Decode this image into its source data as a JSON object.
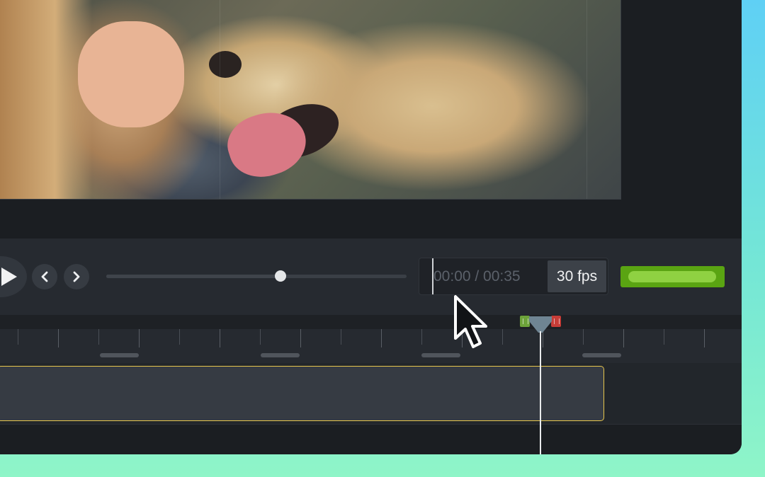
{
  "player": {
    "timecode_value": "00:00 / 00:35",
    "frame_rate": "30 fps",
    "scrubber_position": 0.58
  },
  "icons": {
    "play": "play-icon",
    "previous": "chevron-left-icon",
    "next": "chevron-right-icon",
    "cursor": "mouse-pointer-icon"
  },
  "colors": {
    "export_button": "#5aa412",
    "clip_border": "#e7c64c",
    "in_marker": "#6da33a",
    "out_marker": "#c73d38",
    "background_gradient_top": "#5fd0f5",
    "background_gradient_bottom": "#8ff5c8"
  }
}
